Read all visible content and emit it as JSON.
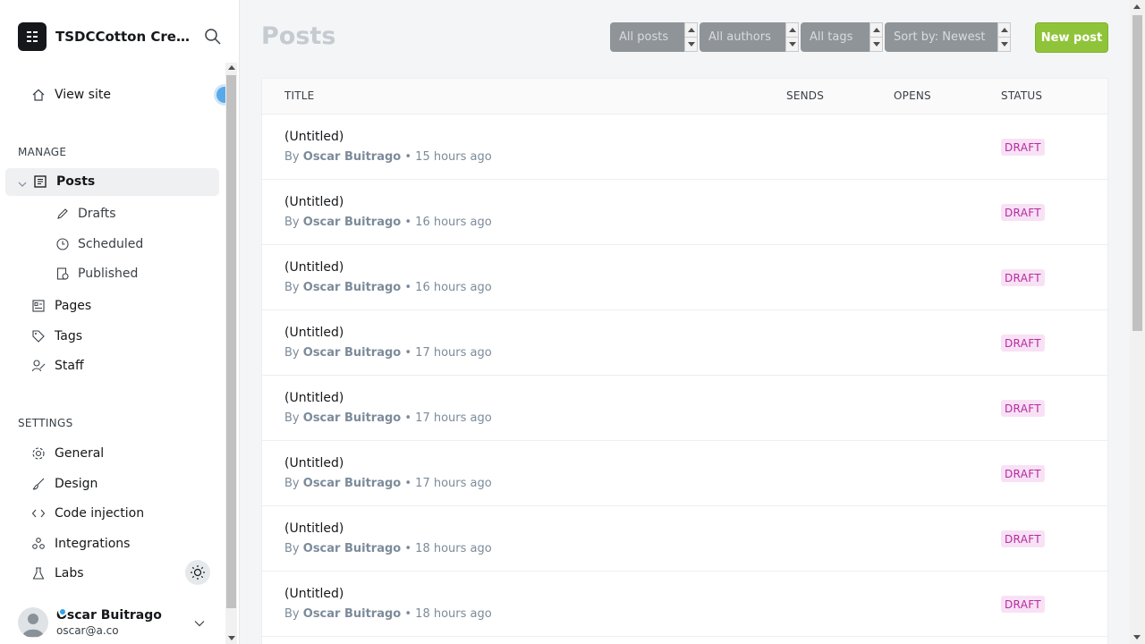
{
  "brand": {
    "title": "TSDCCotton Creative",
    "logo_icon": "ghost-logo-icon",
    "search_icon": "search-icon"
  },
  "sidebar": {
    "view_site": "View site",
    "manage_label": "MANAGE",
    "posts": "Posts",
    "drafts": "Drafts",
    "scheduled": "Scheduled",
    "published": "Published",
    "pages": "Pages",
    "tags": "Tags",
    "staff": "Staff",
    "settings_label": "SETTINGS",
    "general": "General",
    "design": "Design",
    "code_injection": "Code injection",
    "integrations": "Integrations",
    "labs": "Labs"
  },
  "user": {
    "name": "Oscar Buitrago",
    "email": "oscar@a.co"
  },
  "main": {
    "title": "Posts",
    "filters": {
      "posts": "All posts",
      "authors": "All authors",
      "tags": "All tags",
      "sort": "Sort by: Newest"
    },
    "new_post": "New post",
    "columns": {
      "title": "TITLE",
      "sends": "SENDS",
      "opens": "OPENS",
      "status": "STATUS"
    },
    "rows": [
      {
        "title": "(Untitled)",
        "by": "By",
        "author": "Oscar Buitrago",
        "time": "• 15 hours ago",
        "status": "DRAFT"
      },
      {
        "title": "(Untitled)",
        "by": "By",
        "author": "Oscar Buitrago",
        "time": "• 16 hours ago",
        "status": "DRAFT"
      },
      {
        "title": "(Untitled)",
        "by": "By",
        "author": "Oscar Buitrago",
        "time": "• 16 hours ago",
        "status": "DRAFT"
      },
      {
        "title": "(Untitled)",
        "by": "By",
        "author": "Oscar Buitrago",
        "time": "• 17 hours ago",
        "status": "DRAFT"
      },
      {
        "title": "(Untitled)",
        "by": "By",
        "author": "Oscar Buitrago",
        "time": "• 17 hours ago",
        "status": "DRAFT"
      },
      {
        "title": "(Untitled)",
        "by": "By",
        "author": "Oscar Buitrago",
        "time": "• 17 hours ago",
        "status": "DRAFT"
      },
      {
        "title": "(Untitled)",
        "by": "By",
        "author": "Oscar Buitrago",
        "time": "• 18 hours ago",
        "status": "DRAFT"
      },
      {
        "title": "(Untitled)",
        "by": "By",
        "author": "Oscar Buitrago",
        "time": "• 18 hours ago",
        "status": "DRAFT"
      }
    ]
  },
  "colors": {
    "accent": "#8fc43a",
    "draft_badge_bg": "#f8e1f5",
    "draft_badge_text": "#b62aa0"
  }
}
